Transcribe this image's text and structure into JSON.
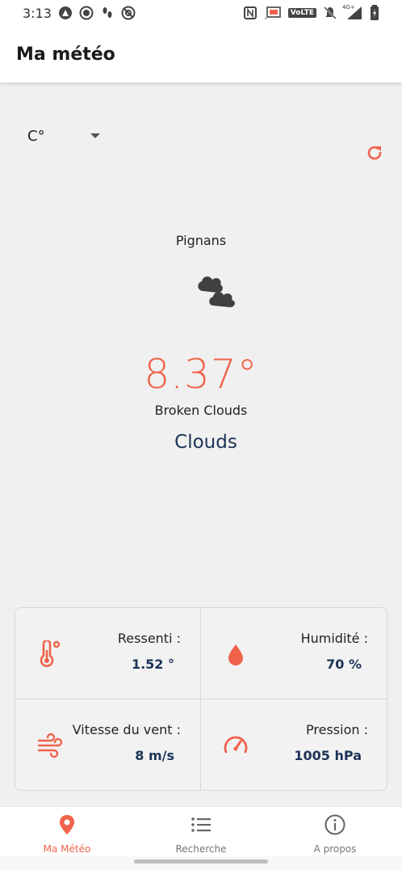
{
  "status_bar": {
    "time": "3:13",
    "left_icons": [
      "app-icon-a",
      "record-icon",
      "footsteps-icon",
      "blocked-icon"
    ],
    "right_icons": [
      "nfc-icon",
      "cast-icon",
      "volte-icon",
      "mute-icon",
      "signal-icon",
      "battery-icon"
    ],
    "volte_text": "VoLTE",
    "network_text": "4G+"
  },
  "app_bar": {
    "title": "Ma météo"
  },
  "unit_selector": {
    "value": "C°"
  },
  "weather": {
    "city": "Pignans",
    "icon": "broken-clouds-icon",
    "temperature": "8.37°",
    "description": "Broken Clouds",
    "main": "Clouds"
  },
  "stats": {
    "feels_like": {
      "label": "Ressenti :",
      "value": "1.52 °",
      "icon": "thermometer-icon"
    },
    "humidity": {
      "label": "Humidité :",
      "value": "70 %",
      "icon": "water-drop-icon"
    },
    "wind": {
      "label": "Vitesse du vent :",
      "value": "8 m/s",
      "icon": "wind-icon"
    },
    "pressure": {
      "label": "Pression :",
      "value": "1005 hPa",
      "icon": "speedometer-icon"
    }
  },
  "nav": {
    "items": [
      {
        "label": "Ma Météo",
        "icon": "location-pin-icon",
        "active": true
      },
      {
        "label": "Recherche",
        "icon": "list-icon",
        "active": false
      },
      {
        "label": "A propos",
        "icon": "info-icon",
        "active": false
      }
    ]
  },
  "colors": {
    "accent": "#f0634b",
    "navy": "#1c3357",
    "background": "#f0f0f0"
  }
}
